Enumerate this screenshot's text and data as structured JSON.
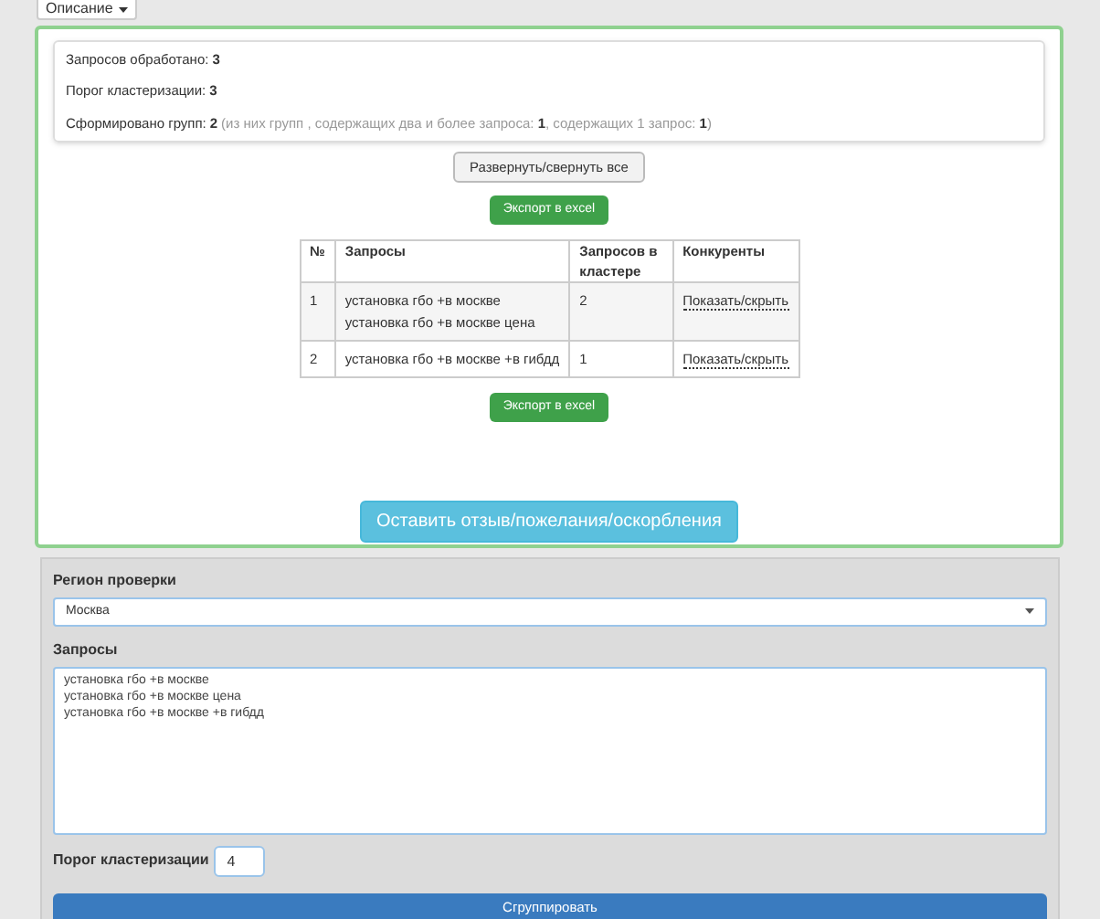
{
  "description_dropdown": {
    "label": "Описание"
  },
  "summary": [
    {
      "label": "Запросов обработано:",
      "value": "3"
    },
    {
      "label": "Порог кластеризации:",
      "value": "3"
    },
    {
      "label": "Сформировано групп:",
      "value": "2",
      "note": "(из них групп , содержащих два и более запроса: **1**, содержащих 1 запрос: **1**)"
    }
  ],
  "toggle_button": "Развернуть/свернуть все",
  "export_buttons": [
    "Экспорт в excel",
    "Экспорт в excel"
  ],
  "table": {
    "columns": [
      "№",
      "Запросы",
      "Запросов в кластере",
      "Конкуренты"
    ],
    "rows": [
      {
        "number": "1",
        "queries": [
          "установка гбо +в москве",
          "установка гбо +в москве цена"
        ],
        "count": "2",
        "competitors": "Показать/скрыть"
      },
      {
        "number": "2",
        "queries": [
          "установка гбо +в москве +в гибдд"
        ],
        "count": "1",
        "competitors": "Показать/скрыть"
      }
    ]
  },
  "feedback_button": "Оставить отзыв/пожелания/оскорбления",
  "form": {
    "region_label": "Регион проверки",
    "region_value": "Москва",
    "queries_label": "Запросы",
    "queries_value": "установка гбо +в москве\nустановка гбо +в москве цена\nустановка гбо +в москве +в гибдд",
    "threshold_label": "Порог кластеризации",
    "threshold_value": "4",
    "submit": "Сгруппировать"
  }
}
